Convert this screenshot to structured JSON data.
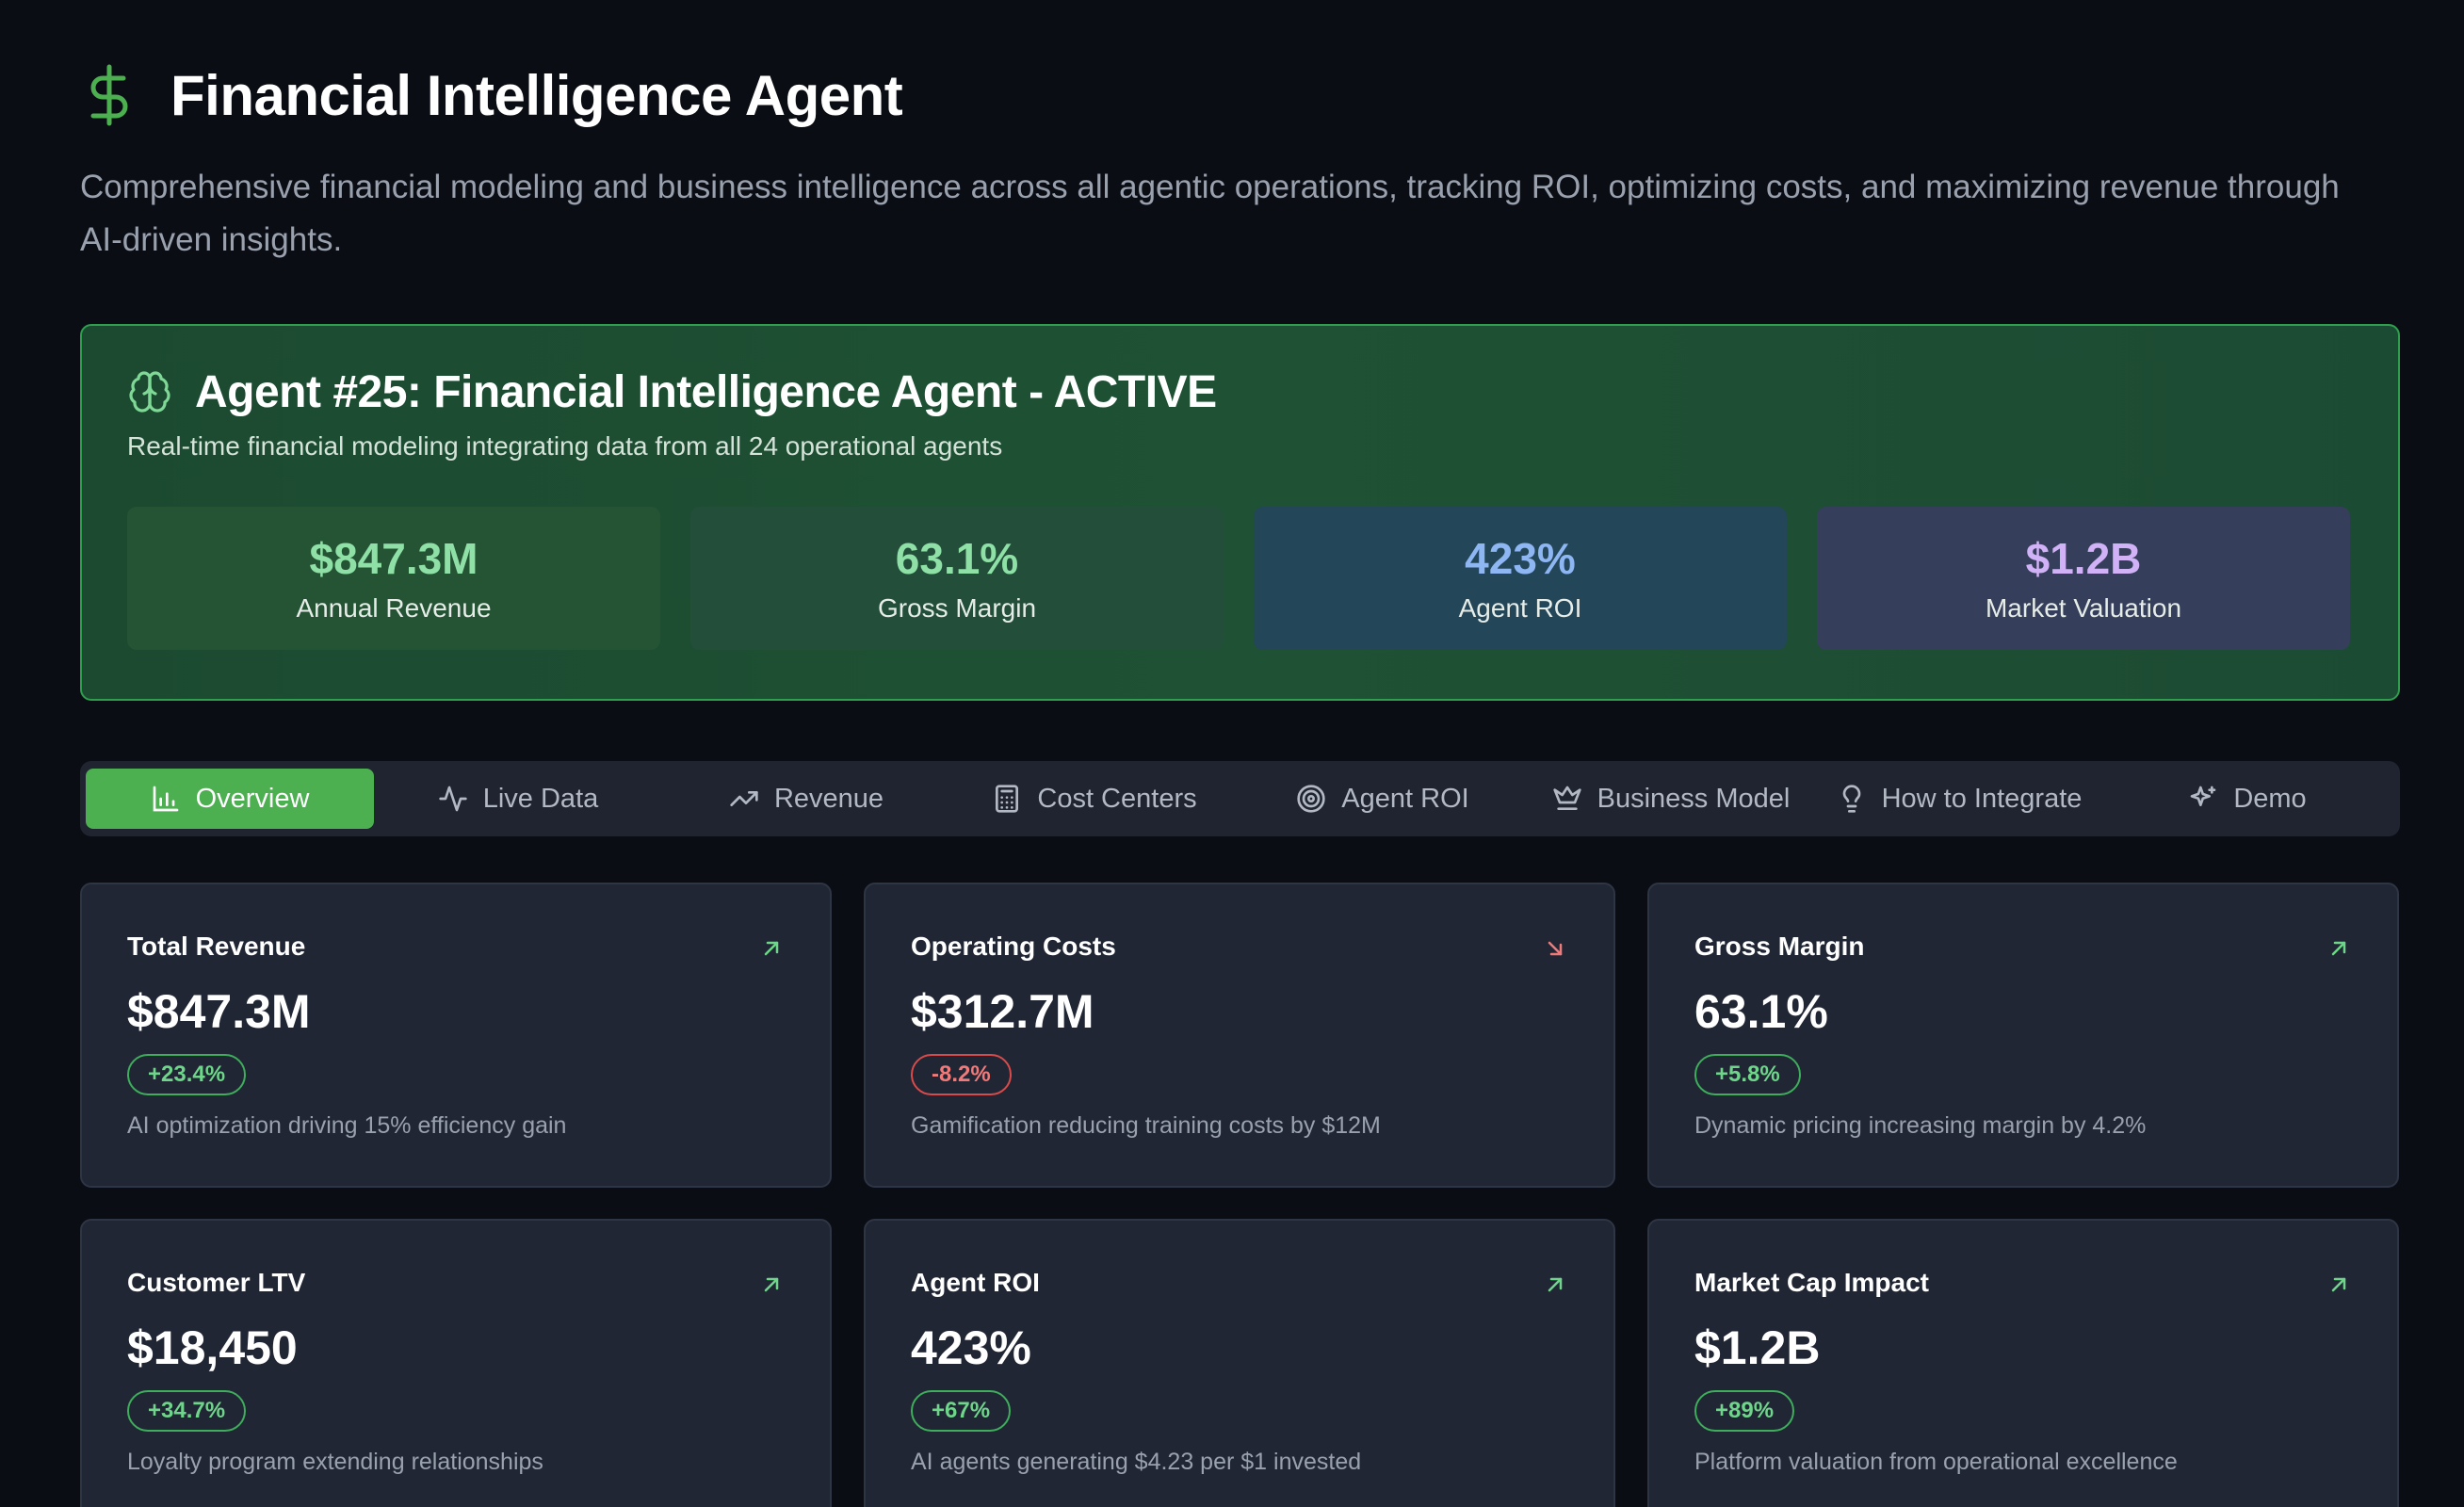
{
  "header": {
    "icon": "dollar-icon",
    "title": "Financial Intelligence Agent",
    "description": "Comprehensive financial modeling and business intelligence across all agentic operations, tracking ROI, optimizing costs, and maximizing revenue through AI-driven insights."
  },
  "agent_panel": {
    "icon": "brain-icon",
    "title": "Agent #25: Financial Intelligence Agent - ACTIVE",
    "subtitle": "Real-time financial modeling integrating data from all 24 operational agents",
    "kpis": [
      {
        "value": "$847.3M",
        "label": "Annual Revenue",
        "color": "#8fe0a6"
      },
      {
        "value": "63.1%",
        "label": "Gross Margin",
        "color": "#8fe0a6"
      },
      {
        "value": "423%",
        "label": "Agent ROI",
        "color": "#8db6f2"
      },
      {
        "value": "$1.2B",
        "label": "Market Valuation",
        "color": "#d2b2f6"
      }
    ]
  },
  "tabs": [
    {
      "label": "Overview",
      "icon": "bar-chart-icon",
      "active": true
    },
    {
      "label": "Live Data",
      "icon": "activity-icon",
      "active": false
    },
    {
      "label": "Revenue",
      "icon": "trending-up-icon",
      "active": false
    },
    {
      "label": "Cost Centers",
      "icon": "calculator-icon",
      "active": false
    },
    {
      "label": "Agent ROI",
      "icon": "target-icon",
      "active": false
    },
    {
      "label": "Business Model",
      "icon": "crown-icon",
      "active": false
    },
    {
      "label": "How to Integrate",
      "icon": "lightbulb-icon",
      "active": false
    },
    {
      "label": "Demo",
      "icon": "sparkles-icon",
      "active": false
    }
  ],
  "cards": [
    {
      "title": "Total Revenue",
      "value": "$847.3M",
      "change": "+23.4%",
      "trend": "up",
      "note": "AI optimization driving 15% efficiency gain"
    },
    {
      "title": "Operating Costs",
      "value": "$312.7M",
      "change": "-8.2%",
      "trend": "down",
      "note": "Gamification reducing training costs by $12M"
    },
    {
      "title": "Gross Margin",
      "value": "63.1%",
      "change": "+5.8%",
      "trend": "up",
      "note": "Dynamic pricing increasing margin by 4.2%"
    },
    {
      "title": "Customer LTV",
      "value": "$18,450",
      "change": "+34.7%",
      "trend": "up",
      "note": "Loyalty program extending relationships"
    },
    {
      "title": "Agent ROI",
      "value": "423%",
      "change": "+67%",
      "trend": "up",
      "note": "AI agents generating $4.23 per $1 invested"
    },
    {
      "title": "Market Cap Impact",
      "value": "$1.2B",
      "change": "+89%",
      "trend": "up",
      "note": "Platform valuation from operational excellence"
    }
  ],
  "colors": {
    "accent_green": "#4caf50",
    "positive": "#6fd58a",
    "negative": "#f07a7a"
  }
}
